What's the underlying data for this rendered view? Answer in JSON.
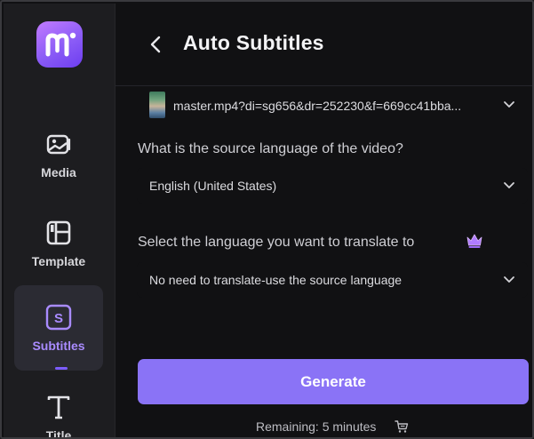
{
  "sidebar": {
    "items": [
      {
        "label": "Media",
        "icon": "image-icon"
      },
      {
        "label": "Template",
        "icon": "template-icon"
      },
      {
        "label": "Subtitles",
        "icon": "subtitles-icon",
        "active": true
      },
      {
        "label": "Title",
        "icon": "title-icon"
      }
    ]
  },
  "header": {
    "title": "Auto Subtitles"
  },
  "file": {
    "name": "master.mp4?di=sg656&dr=252230&f=669cc41bba..."
  },
  "source": {
    "question": "What is the source language of the video?",
    "value": "English (United States)"
  },
  "translate": {
    "question": "Select the language you want to translate to",
    "value": "No need to translate-use the source language"
  },
  "actions": {
    "generate_label": "Generate"
  },
  "footer": {
    "remaining": "Remaining: 5 minutes"
  },
  "colors": {
    "accent": "#8a73f6",
    "active_label": "#a98bff",
    "background": "#111113"
  }
}
